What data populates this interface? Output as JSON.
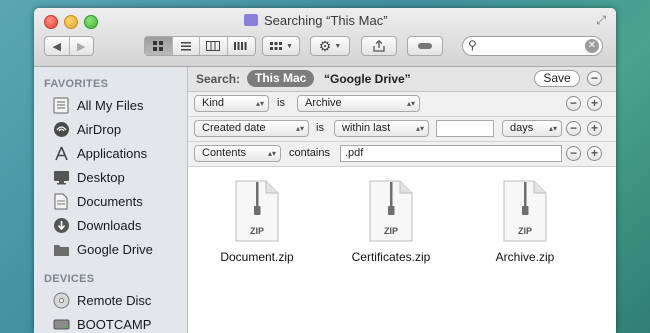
{
  "window": {
    "title": "Searching “This Mac”"
  },
  "toolbar": {
    "back_label": "◀",
    "forward_label": "▶",
    "search": {
      "value": "",
      "placeholder": ""
    }
  },
  "sidebar": {
    "favorites_header": "FAVORITES",
    "favorites": [
      {
        "label": "All My Files",
        "icon": "all-files-icon"
      },
      {
        "label": "AirDrop",
        "icon": "airdrop-icon"
      },
      {
        "label": "Applications",
        "icon": "applications-icon"
      },
      {
        "label": "Desktop",
        "icon": "desktop-icon"
      },
      {
        "label": "Documents",
        "icon": "documents-icon"
      },
      {
        "label": "Downloads",
        "icon": "downloads-icon"
      },
      {
        "label": "Google Drive",
        "icon": "folder-icon"
      }
    ],
    "devices_header": "DEVICES",
    "devices": [
      {
        "label": "Remote Disc",
        "icon": "disc-icon"
      },
      {
        "label": "BOOTCAMP",
        "icon": "drive-icon"
      }
    ]
  },
  "scope": {
    "label": "Search:",
    "active": "This Mac",
    "other": "“Google Drive”",
    "save_label": "Save"
  },
  "rules": [
    {
      "attribute": "Kind",
      "operator": "is",
      "value": "Archive"
    },
    {
      "attribute": "Created date",
      "operator": "is",
      "qualifier": "within last",
      "amount": "",
      "unit": "days"
    },
    {
      "attribute": "Contents",
      "operator": "contains",
      "value": ".pdf"
    }
  ],
  "files": [
    {
      "name": "Document.zip",
      "badge": "ZIP"
    },
    {
      "name": "Certificates.zip",
      "badge": "ZIP"
    },
    {
      "name": "Archive.zip",
      "badge": "ZIP"
    }
  ],
  "colors": {
    "scope_pill": "#7c7c7c",
    "sidebar_bg": "#e3e7ec",
    "sidebar_header": "#7d8690"
  }
}
